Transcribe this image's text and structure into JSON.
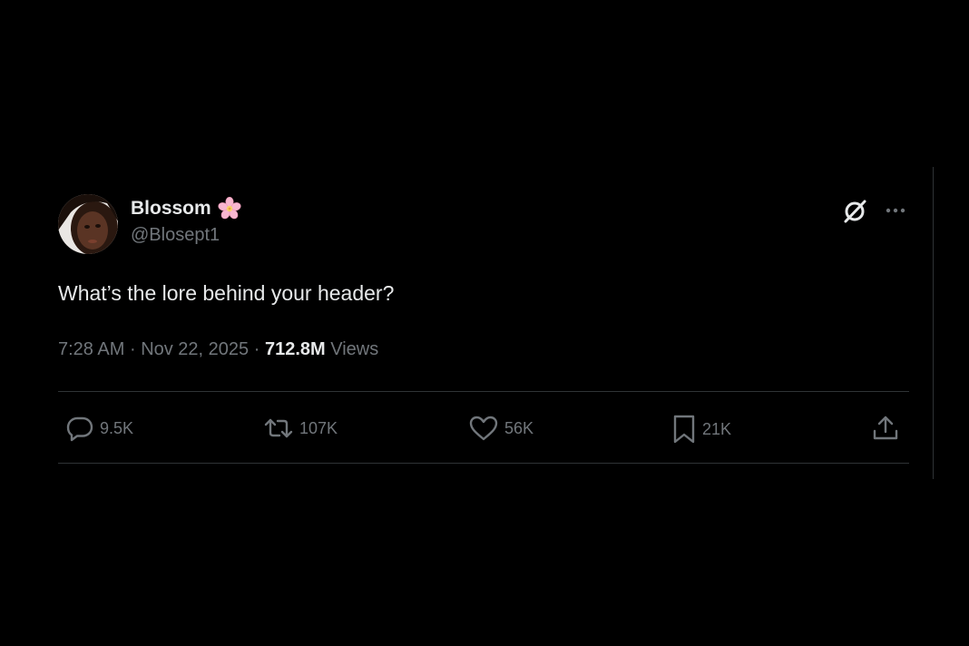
{
  "tweet": {
    "author": {
      "display_name": "Blossom",
      "handle": "@Blosept1",
      "name_emoji": "cherry-blossom"
    },
    "text": "What’s the lore behind your header?",
    "time": "7:28 AM",
    "separator": "·",
    "date": "Nov 22, 2025",
    "views_count": "712.8M",
    "views_label": "Views"
  },
  "actions": {
    "reply_count": "9.5K",
    "retweet_count": "107K",
    "like_count": "56K",
    "bookmark_count": "21K"
  },
  "icons": {
    "top_right": [
      "grok-icon",
      "more-icon"
    ],
    "actions": [
      "reply-icon",
      "retweet-icon",
      "like-icon",
      "bookmark-icon",
      "share-icon"
    ]
  },
  "colors": {
    "background": "#000000",
    "primary_text": "#e7e9ea",
    "secondary_text": "#71767b",
    "divider": "#2f3336"
  }
}
